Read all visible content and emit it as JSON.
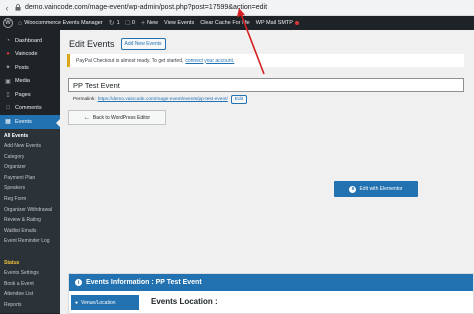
{
  "browser": {
    "url": "demo.vaincode.com/mage-event/wp-admin/post.php?post=17599&action=edit"
  },
  "adminbar": {
    "site_name": "Woocommerce Events Manager",
    "updates_count": "1",
    "comments_count": "0",
    "new_label": "New",
    "view_events_label": "View Events",
    "clear_cache_label": "Clear Cache For Me",
    "smtp_label": "WP Mail SMTP"
  },
  "sidebar": {
    "items": [
      {
        "label": "Dashboard",
        "icon": "dashboard-icon"
      },
      {
        "label": "Vaincode",
        "icon": "vaincode-icon"
      },
      {
        "label": "Posts",
        "icon": "posts-icon"
      },
      {
        "label": "Media",
        "icon": "media-icon"
      },
      {
        "label": "Pages",
        "icon": "pages-icon"
      },
      {
        "label": "Comments",
        "icon": "comments-icon"
      },
      {
        "label": "Events",
        "icon": "events-icon"
      }
    ],
    "submenu": [
      "All Events",
      "Add New Events",
      "Category",
      "Organizer",
      "Payment Plan",
      "Speakers",
      "Reg Form",
      "Organizer Withdrawal",
      "Review & Rating",
      "Waitlist Emails",
      "Event Reminder Log",
      "",
      "Status",
      "Events Settings",
      "Book a Event",
      "Attendee List",
      "Reports"
    ]
  },
  "main": {
    "title": "Edit Events",
    "add_new_label": "Add New Events",
    "notice_text": "PayPal Checkout is almost ready. To get started,",
    "notice_link": "connect your account.",
    "post_title": "PP Test Event",
    "permalink_label": "Permalink:",
    "permalink_url": "https://demo.vaincode.com/mage-event/events/pp-test-event/",
    "permalink_edit": "Edit",
    "back_button": "Back to WordPress Editor",
    "elementor_button": "Edit with Elementor",
    "events_info_title": "Events Information : PP Test Event",
    "venue_tab": "Venue/Location",
    "events_location_title": "Events Location :"
  },
  "colors": {
    "wp_dark": "#1d2327",
    "wp_blue": "#2271b1",
    "notice_border": "#dba617",
    "annotation_red": "#d42020"
  }
}
